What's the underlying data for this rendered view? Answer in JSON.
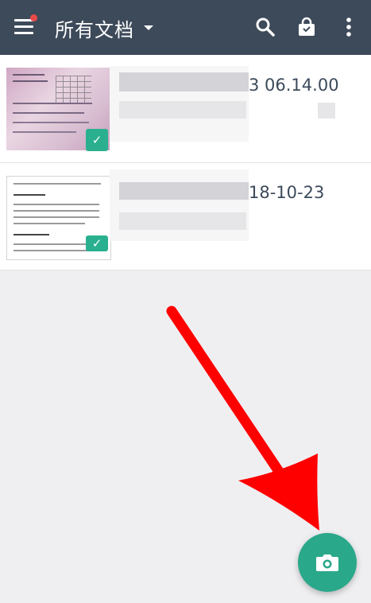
{
  "appbar": {
    "title": "所有文档",
    "icons": [
      "menu-icon",
      "search-icon",
      "bag-icon",
      "more-vert-icon"
    ]
  },
  "documents": [
    {
      "date": "3 06.14.00"
    },
    {
      "date": "18-10-23"
    }
  ],
  "fab": {
    "icon": "camera-icon"
  },
  "colors": {
    "appbar": "#3d4a5a",
    "accent": "#2aa88a",
    "notification_dot": "#e84a4a",
    "annotation_arrow": "#ff0000"
  }
}
